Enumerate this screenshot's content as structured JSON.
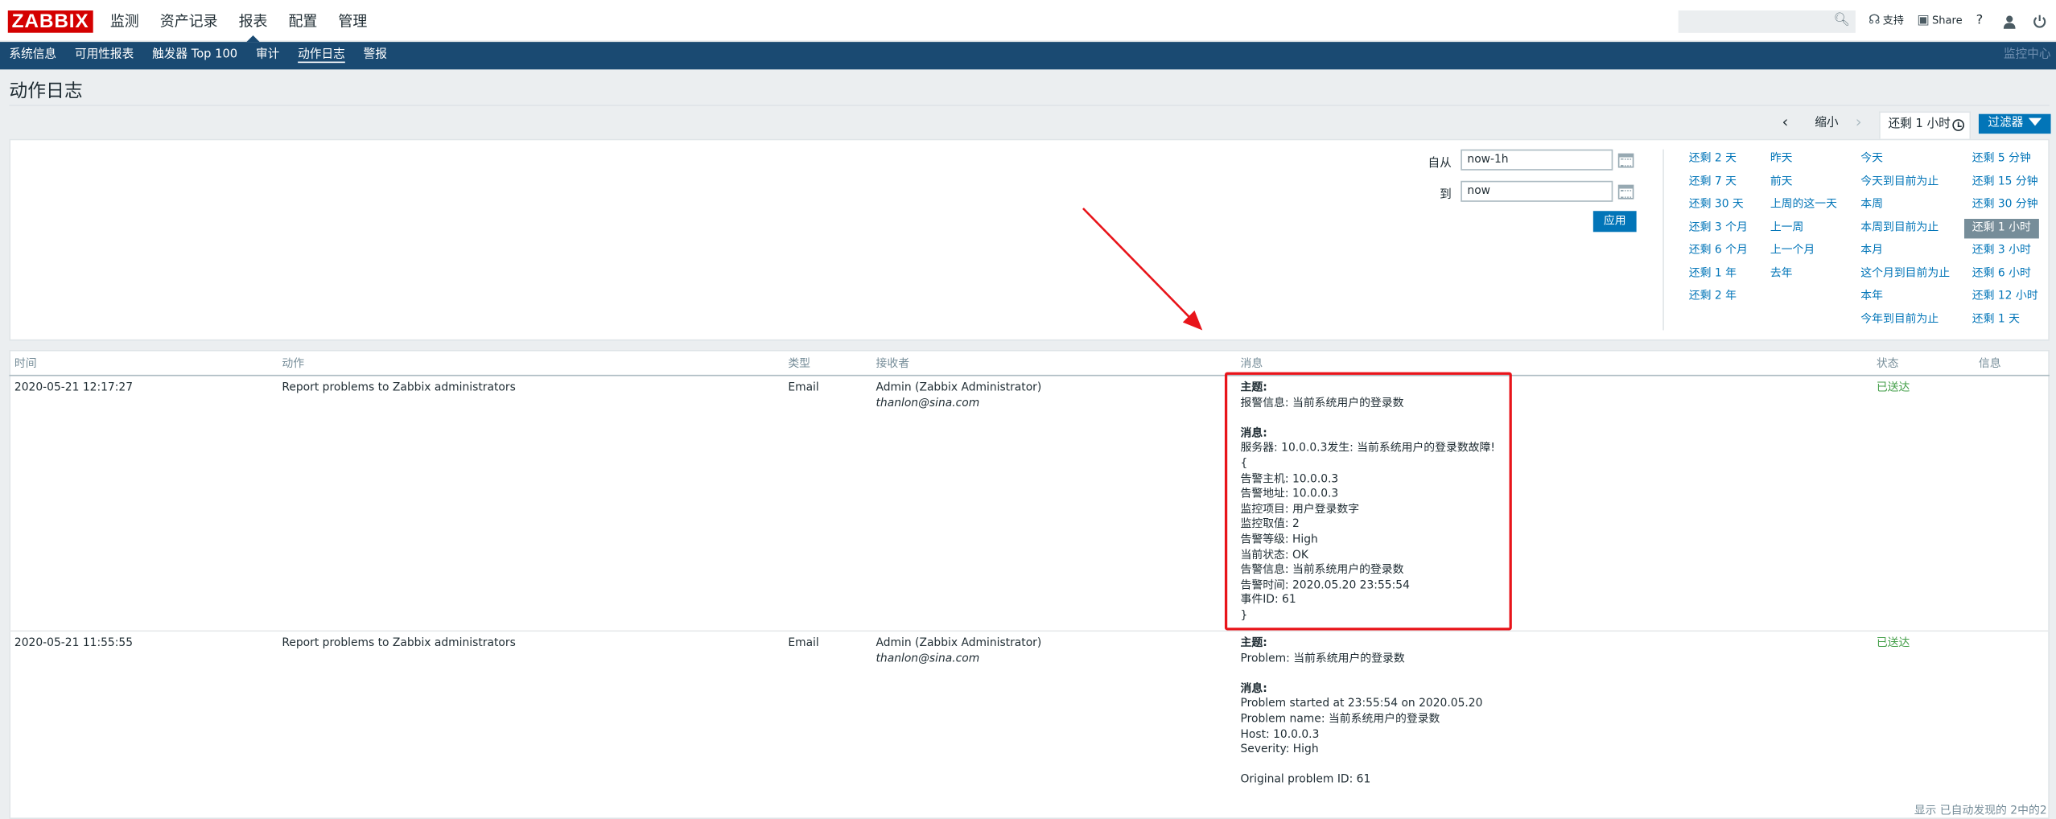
{
  "app": {
    "logo": "ZABBIX"
  },
  "main_nav": [
    "监测",
    "资产记录",
    "报表",
    "配置",
    "管理"
  ],
  "main_nav_active": 2,
  "top_right": {
    "support": "支持",
    "share": "Share",
    "help": "?"
  },
  "sub_nav": [
    "系统信息",
    "可用性报表",
    "触发器 Top 100",
    "审计",
    "动作日志",
    "警报"
  ],
  "sub_nav_active": 4,
  "sub_right": "监控中心",
  "page_title": "动作日志",
  "time_tabs": {
    "zoom_out": "缩小",
    "current": "还剩 1 小时",
    "filter": "过滤器"
  },
  "filter": {
    "from_label": "自从",
    "from_value": "now-1h",
    "to_label": "到",
    "to_value": "now",
    "apply": "应用"
  },
  "quick_ranges": [
    [
      "还剩 2 天",
      "还剩 7 天",
      "还剩 30 天",
      "还剩 3 个月",
      "还剩 6 个月",
      "还剩 1 年",
      "还剩 2 年"
    ],
    [
      "昨天",
      "前天",
      "上周的这一天",
      "上一周",
      "上一个月",
      "去年"
    ],
    [
      "今天",
      "今天到目前为止",
      "本周",
      "本周到目前为止",
      "本月",
      "这个月到目前为止",
      "本年",
      "今年到目前为止"
    ],
    [
      "还剩 5 分钟",
      "还剩 15 分钟",
      "还剩 30 分钟",
      "还剩 1 小时",
      "还剩 3 小时",
      "还剩 6 小时",
      "还剩 12 小时",
      "还剩 1 天"
    ]
  ],
  "quick_selected": "还剩 1 小时",
  "table": {
    "headers": [
      "时间",
      "动作",
      "类型",
      "接收者",
      "消息",
      "状态",
      "信息"
    ],
    "rows": [
      {
        "time": "2020-05-21 12:17:27",
        "action": "Report problems to Zabbix administrators",
        "type": "Email",
        "recipient": "Admin (Zabbix Administrator)",
        "recipient_email": "thanlon@sina.com",
        "message": [
          "主题:",
          "报警信息: 当前系统用户的登录数",
          "",
          "消息:",
          "服务器: 10.0.0.3发生: 当前系统用户的登录数故障!",
          "{",
          "告警主机:  10.0.0.3",
          "告警地址:  10.0.0.3",
          "监控项目:  用户登录数字",
          "监控取值:  2",
          "告警等级:  High",
          "当前状态:  OK",
          "告警信息:  当前系统用户的登录数",
          "告警时间:  2020.05.20 23:55:54",
          "事件ID:  61",
          "}"
        ],
        "status": "已送达"
      },
      {
        "time": "2020-05-21 11:55:55",
        "action": "Report problems to Zabbix administrators",
        "type": "Email",
        "recipient": "Admin (Zabbix Administrator)",
        "recipient_email": "thanlon@sina.com",
        "message": [
          "主题:",
          "Problem: 当前系统用户的登录数",
          "",
          "消息:",
          "Problem started at 23:55:54 on 2020.05.20",
          "Problem name: 当前系统用户的登录数",
          "Host: 10.0.0.3",
          "Severity: High",
          "",
          "Original problem ID: 61"
        ],
        "status": "已送达"
      }
    ]
  },
  "footer": "显示 已自动发现的 2中的2",
  "colors": {
    "brand": "#d40000",
    "subnav": "#1a4a72",
    "link": "#0275b8",
    "ok": "#429e47",
    "annotation": "#e8141a"
  }
}
